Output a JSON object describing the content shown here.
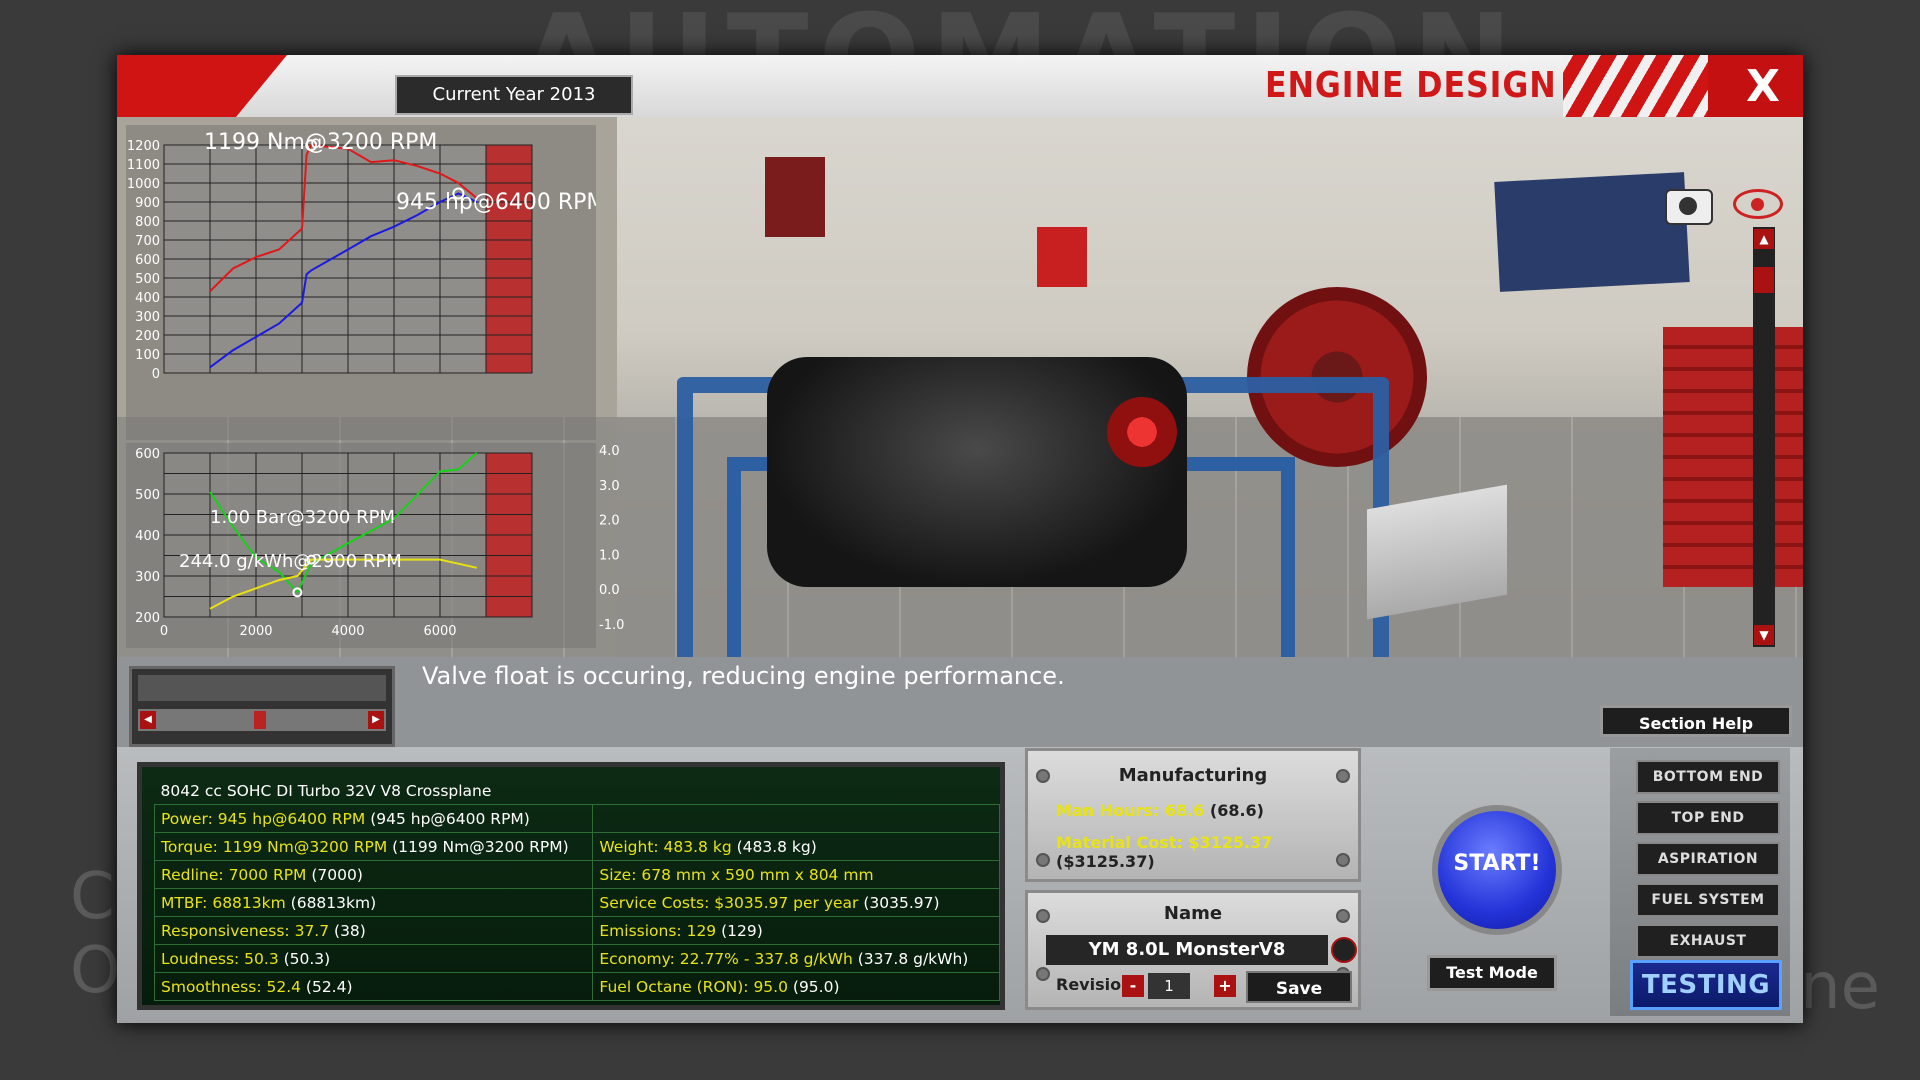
{
  "header": {
    "current_year": "Current Year 2013",
    "title": "ENGINE DESIGN",
    "close_label": "X"
  },
  "background_text": {
    "logo_word": "AUTOMATION",
    "left_fragment": "C\nO",
    "right_fragment": "ne"
  },
  "charts": {
    "top_yticks": [
      "1200",
      "1100",
      "1000",
      "900",
      "800",
      "700",
      "600",
      "500",
      "400",
      "300",
      "200",
      "100",
      "0"
    ],
    "top_annotation_torque": "1199 Nm@3200 RPM",
    "top_annotation_power": "945 hp@6400 RPM",
    "bottom_yticks_left": [
      "600",
      "500",
      "400",
      "300",
      "200"
    ],
    "bottom_yticks_right": [
      "4.0",
      "3.0",
      "2.0",
      "1.0",
      "0.0",
      "-1.0"
    ],
    "bottom_xticks": [
      "0",
      "2000",
      "4000",
      "6000"
    ],
    "bottom_annotation_boost": "1.00 Bar@3200 RPM",
    "bottom_annotation_bsfc": "244.0 g/kWh@2900 RPM",
    "colors": {
      "torque": "#e01818",
      "power": "#1a1ae0",
      "boost": "#e8e010",
      "bsfc": "#18d018",
      "redline": "#b83030"
    }
  },
  "chart_data": [
    {
      "type": "line",
      "x": [
        1000,
        1500,
        2000,
        2500,
        3000,
        3100,
        3200,
        4000,
        4500,
        5000,
        5500,
        6000,
        6400,
        6800
      ],
      "series": [
        {
          "name": "",
          "values": [
            430,
            550,
            610,
            650,
            760,
            1150,
            1199,
            1180,
            1110,
            1120,
            1090,
            1050,
            1000,
            920
          ]
        },
        {
          "name": "",
          "values": [
            30,
            120,
            190,
            260,
            370,
            520,
            540,
            650,
            720,
            770,
            830,
            900,
            945,
            900
          ]
        }
      ],
      "ylim": [
        0,
        1200
      ],
      "xlim": [
        0,
        8000
      ],
      "redline_rpm": 7000,
      "grid": true,
      "xlabel": "",
      "ylabel": ""
    },
    {
      "type": "line",
      "x": [
        1000,
        1500,
        2000,
        2500,
        2900,
        3200,
        4000,
        5000,
        6000,
        6400,
        6800
      ],
      "series": [
        {
          "name": "",
          "values": [
            505,
            420,
            345,
            310,
            260,
            330,
            380,
            440,
            555,
            560,
            600
          ]
        },
        {
          "name": "",
          "values": [
            220,
            250,
            270,
            290,
            300,
            340,
            340,
            340,
            340,
            330,
            320
          ]
        }
      ],
      "ylim": [
        200,
        600
      ],
      "y2lim": [
        -1.0,
        4.0
      ],
      "xlim": [
        0,
        8000
      ],
      "grid": true,
      "xlabel": "",
      "ylabel": ""
    }
  ],
  "message": "Valve float is occuring, reducing engine performance.",
  "section_help": "Section Help",
  "stats": {
    "header": "8042 cc SOHC DI Turbo 32V V8 Crossplane",
    "rows": [
      {
        "left_label": "Power: 945 hp@6400 RPM",
        "left_value": " (945 hp@6400 RPM)",
        "right_label": "",
        "right_value": ""
      },
      {
        "left_label": "Torque: 1199 Nm@3200 RPM",
        "left_value": " (1199 Nm@3200 RPM)",
        "right_label": "Weight: 483.8 kg",
        "right_value": " (483.8 kg)"
      },
      {
        "left_label": "Redline: 7000 RPM",
        "left_value": " (7000)",
        "right_label": "Size: 678 mm x 590 mm x 804 mm",
        "right_value": ""
      },
      {
        "left_label": "MTBF: 68813km",
        "left_value": " (68813km)",
        "right_label": "Service Costs: $3035.97 per year",
        "right_value": " (3035.97)"
      },
      {
        "left_label": "Responsiveness: 37.7",
        "left_value": " (38)",
        "right_label": "Emissions: 129",
        "right_value": " (129)"
      },
      {
        "left_label": "Loudness: 50.3",
        "left_value": " (50.3)",
        "right_label": "Economy: 22.77% - 337.8 g/kWh",
        "right_value": " (337.8 g/kWh)"
      },
      {
        "left_label": "Smoothness: 52.4",
        "left_value": " (52.4)",
        "right_label": "Fuel Octane (RON): 95.0",
        "right_value": " (95.0)"
      }
    ]
  },
  "manufacturing": {
    "title": "Manufacturing",
    "man_hours_label": "Man Hours: 68.6",
    "man_hours_value": " (68.6)",
    "material_cost_label": "Material Cost: $3125.37",
    "material_cost_value": " ($3125.37)"
  },
  "name_panel": {
    "title": "Name",
    "engine_name": "YM 8.0L MonsterV8",
    "revision_label": "Revision",
    "revision_value": "1",
    "minus": "-",
    "plus": "+",
    "save_label": "Save"
  },
  "start_label": "START!",
  "test_mode_label": "Test Mode",
  "tabs": [
    {
      "label": "BOTTOM END"
    },
    {
      "label": "TOP END"
    },
    {
      "label": "ASPIRATION"
    },
    {
      "label": "FUEL SYSTEM"
    },
    {
      "label": "EXHAUST"
    },
    {
      "label": "TESTING"
    }
  ]
}
